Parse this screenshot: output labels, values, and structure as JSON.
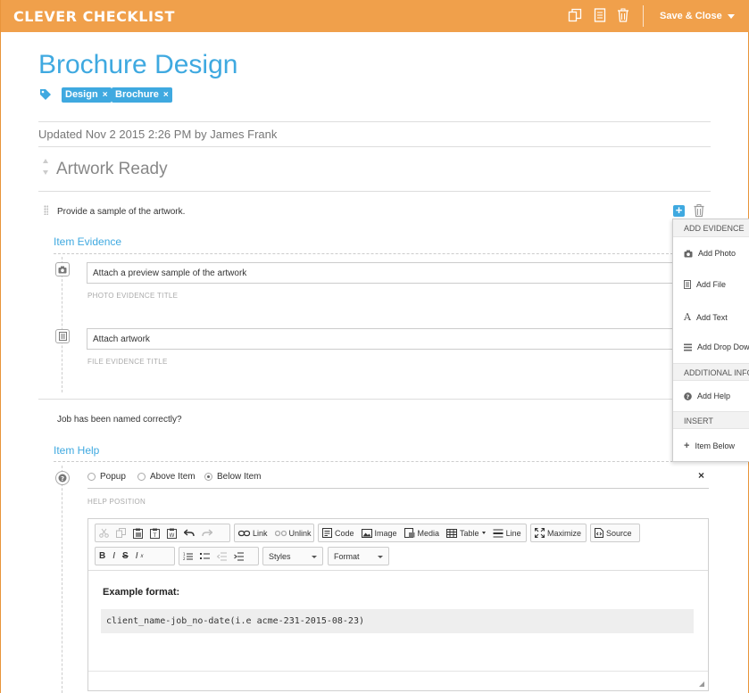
{
  "app": {
    "logo": "CLEVER CHECKLIST",
    "save_close": "Save & Close"
  },
  "header_icons": [
    "copy-icon",
    "document-icon",
    "trash-icon",
    "caret-down-icon"
  ],
  "colors": {
    "header": "#f0a04b",
    "accent": "#3fa9e0"
  },
  "checklist": {
    "title": "Brochure Design",
    "tags": [
      {
        "label": "Design",
        "remove": "×"
      },
      {
        "label": "Brochure",
        "remove": "×"
      }
    ],
    "updated": "Updated Nov 2 2015 2:26 PM by James Frank"
  },
  "section": {
    "title": "Artwork Ready"
  },
  "item1": {
    "text": "Provide a sample of the artwork.",
    "evidence_label": "Item Evidence",
    "evidence": [
      {
        "type": "photo",
        "value": "Attach a preview sample of the artwork",
        "caption": "PHOTO EVIDENCE TITLE"
      },
      {
        "type": "file",
        "value": "Attach artwork",
        "caption": "FILE EVIDENCE TITLE"
      }
    ]
  },
  "menu": {
    "add_evidence_header": "ADD EVIDENCE",
    "add_photo": "Add Photo",
    "add_file": "Add File",
    "add_text": "Add Text",
    "add_dropdown": "Add Drop Dow",
    "additional_header": "ADDITIONAL INFO",
    "add_help": "Add Help",
    "insert_header": "INSERT",
    "item_below": "Item Below"
  },
  "item2": {
    "text": "Job has been named correctly?",
    "help_label": "Item Help",
    "positions": [
      {
        "label": "Popup",
        "selected": false
      },
      {
        "label": "Above Item",
        "selected": false
      },
      {
        "label": "Below Item",
        "selected": true
      }
    ],
    "position_caption": "HELP POSITION",
    "close": "×"
  },
  "editor": {
    "toolbar": {
      "link": "Link",
      "unlink": "Unlink",
      "code": "Code",
      "image": "Image",
      "media": "Media",
      "table": "Table",
      "line": "Line",
      "maximize": "Maximize",
      "source": "Source",
      "styles": "Styles",
      "format": "Format"
    },
    "content_heading": "Example format:",
    "content_code": "client_name-job_no-date(i.e acme-231-2015-08-23)"
  }
}
